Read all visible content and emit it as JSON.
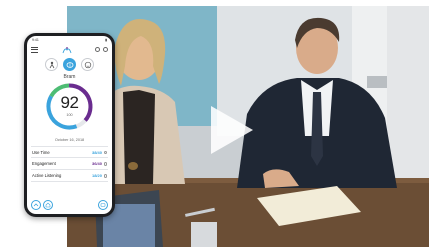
{
  "phone": {
    "status_time": "9:41",
    "user_name": "Bram",
    "score": "92",
    "score_max": "100",
    "score_fraction": 0.92,
    "date": "October 16, 2018",
    "metrics": [
      {
        "label": "Use Time",
        "value": "38/40",
        "color": "#3aa3dd"
      },
      {
        "label": "Engagement",
        "value": "36/40",
        "color": "#6a2c8f"
      },
      {
        "label": "Active Listening",
        "value": "18/20",
        "color": "#3aa3dd"
      }
    ]
  },
  "colors": {
    "ring_blue": "#3aa3dd",
    "ring_green": "#4dbd74",
    "ring_purple": "#6a2c8f",
    "accent": "#3aa3dd"
  },
  "icons": {
    "play": "play-icon",
    "menu": "hamburger-icon",
    "logo": "app-logo-icon"
  }
}
